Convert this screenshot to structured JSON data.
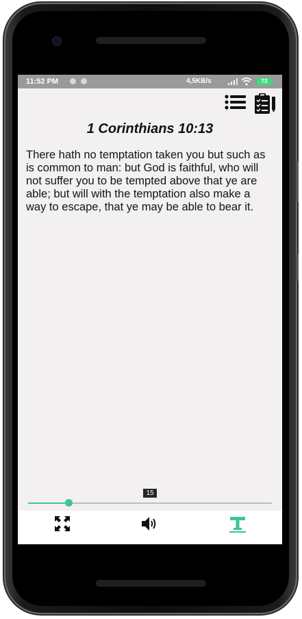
{
  "status_bar": {
    "time": "11:52 PM",
    "network_speed": "4,5KB/s",
    "battery_level": "73"
  },
  "toolbar": {
    "menu_icon": "list-icon",
    "clipboard_icon": "clipboard-checklist-icon"
  },
  "passage": {
    "reference": "1 Corinthians 10:13",
    "text": "There hath no temptation taken you but such as is common to man: but God is faithful, who will not suffer you to be tempted above that ye are able; but will with the temptation also make a way to escape, that ye may be able to bear it."
  },
  "font_slider": {
    "value": 15,
    "label": "15",
    "min": 10,
    "max": 40
  },
  "bottom_nav": [
    {
      "name": "fullscreen",
      "icon": "expand-arrows-icon",
      "active": false
    },
    {
      "name": "audio",
      "icon": "speaker-icon",
      "active": false
    },
    {
      "name": "text-size",
      "icon": "text-format-icon",
      "active": true
    }
  ],
  "colors": {
    "accent": "#3fc493",
    "screen_background": "#f2f0f0",
    "status_bar": "#9a9a9a"
  }
}
